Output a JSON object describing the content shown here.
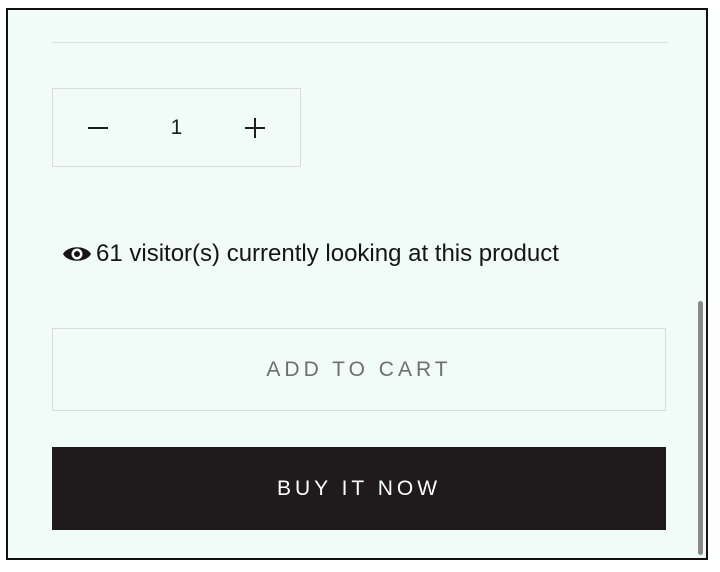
{
  "quantity": {
    "decrement_symbol": "−",
    "value": "1",
    "increment_symbol": "+"
  },
  "visitors": {
    "icon": "eye-icon",
    "text": "61 visitor(s) currently looking at this product"
  },
  "actions": {
    "add_to_cart_label": "ADD TO CART",
    "buy_now_label": "BUY IT NOW"
  },
  "colors": {
    "background": "#f1fbf8",
    "border": "#d8dedb",
    "buy_now_background": "#1f1b1c",
    "buy_now_text": "#ffffff",
    "add_to_cart_text": "#6f6f6f"
  }
}
